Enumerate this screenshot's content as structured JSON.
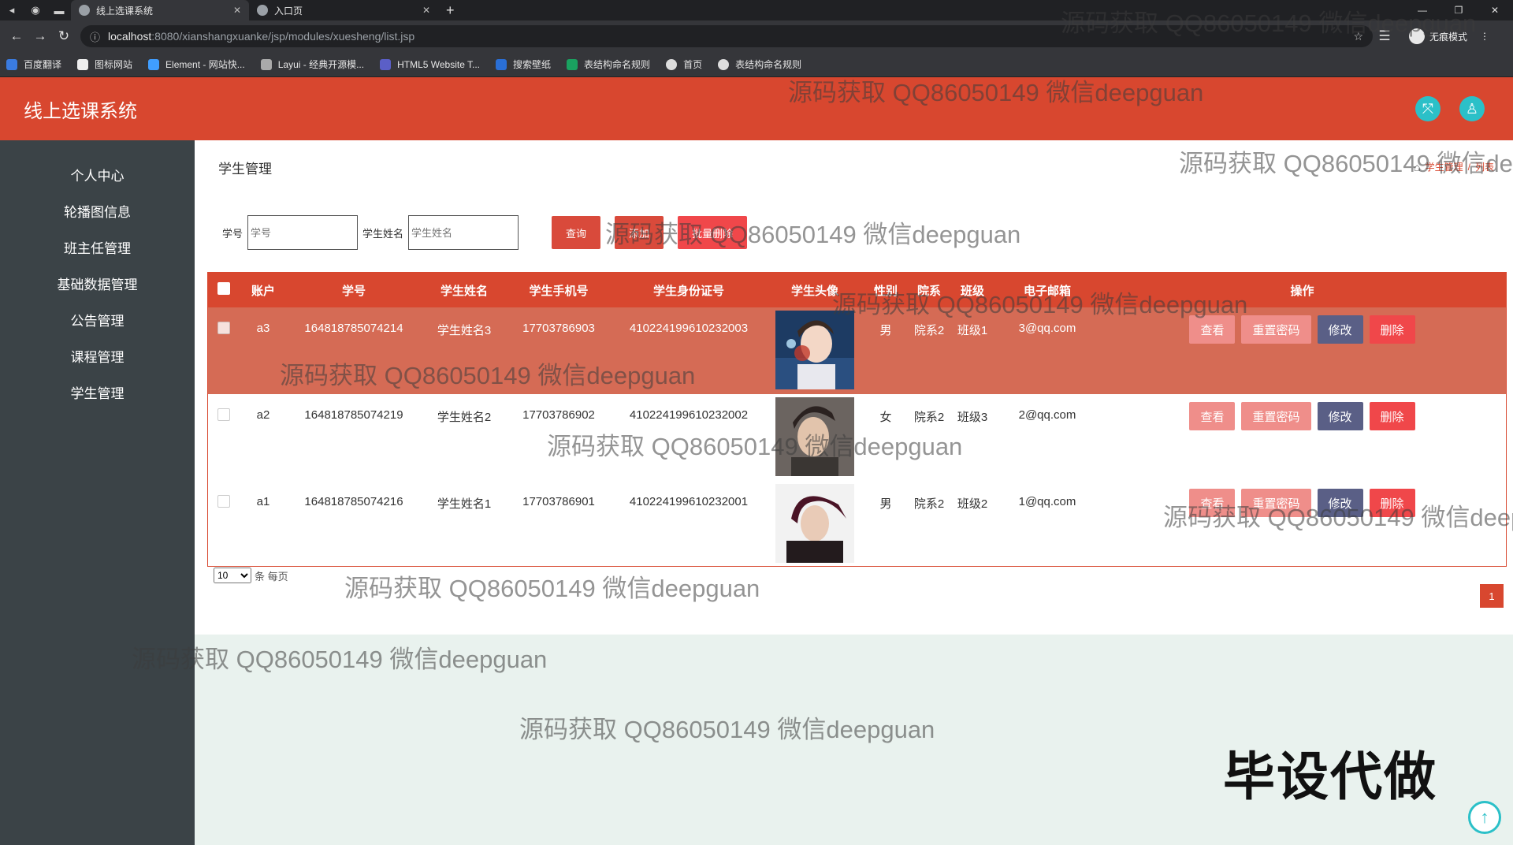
{
  "browser": {
    "tabs": [
      {
        "label": "线上选课系统",
        "close": "✕"
      },
      {
        "label": "入口页",
        "close": "✕"
      }
    ],
    "new_tab": "+",
    "url_host": "localhost",
    "url_rest": ":8080/xianshangxuanke/jsp/modules/xuesheng/list.jsp",
    "profile_label": "无痕模式",
    "bookmarks": [
      "百度翻译",
      "图标网站",
      "Element - 网站快...",
      "Layui - 经典开源模...",
      "HTML5 Website T...",
      "搜索壁纸",
      "表结构命名规则",
      "首页",
      "表结构命名规则"
    ]
  },
  "header": {
    "title": "线上选课系统"
  },
  "sidebar": {
    "items": [
      "个人中心",
      "轮播图信息",
      "班主任管理",
      "基础数据管理",
      "公告管理",
      "课程管理",
      "学生管理"
    ]
  },
  "page": {
    "title": "学生管理",
    "breadcrumb": [
      "学生管理",
      "列表"
    ]
  },
  "search": {
    "xuehao_label": "学号",
    "xuehao_placeholder": "学号",
    "name_label": "学生姓名",
    "name_placeholder": "学生姓名",
    "query_btn": "查询",
    "add_btn": "添加",
    "batch_delete_btn": "批量删除"
  },
  "table": {
    "headers": [
      "账户",
      "学号",
      "学生姓名",
      "学生手机号",
      "学生身份证号",
      "学生头像",
      "性别",
      "院系",
      "班级",
      "电子邮箱",
      "操作"
    ],
    "rows": [
      {
        "account": "a3",
        "xuehao": "164818785074214",
        "name": "学生姓名3",
        "phone": "17703786903",
        "idcard": "410224199610232003",
        "gender": "男",
        "dept": "院系2",
        "cls": "班级1",
        "email": "3@qq.com"
      },
      {
        "account": "a2",
        "xuehao": "164818785074219",
        "name": "学生姓名2",
        "phone": "17703786902",
        "idcard": "410224199610232002",
        "gender": "女",
        "dept": "院系2",
        "cls": "班级3",
        "email": "2@qq.com"
      },
      {
        "account": "a1",
        "xuehao": "164818785074216",
        "name": "学生姓名1",
        "phone": "17703786901",
        "idcard": "410224199610232001",
        "gender": "男",
        "dept": "院系2",
        "cls": "班级2",
        "email": "1@qq.com"
      }
    ],
    "actions": {
      "view": "查看",
      "reset": "重置密码",
      "edit": "修改",
      "delete": "删除"
    }
  },
  "pagination": {
    "page_size": "10",
    "per_page_text": "条 每页",
    "current_page": "1"
  },
  "watermarks": {
    "text": "源码获取 QQ86050149 微信deepguan",
    "big": "毕设代做"
  },
  "colors": {
    "primary": "#d8472f",
    "sidebar": "#3b4347",
    "view_btn": "#ef8e8a",
    "reset_btn": "#ef8e8a",
    "edit_btn": "#5a5f86",
    "delete_btn": "#f0474a",
    "add_btn": "#d94a3b",
    "batch_btn": "#f0474a",
    "accent": "#2bc0c8"
  }
}
